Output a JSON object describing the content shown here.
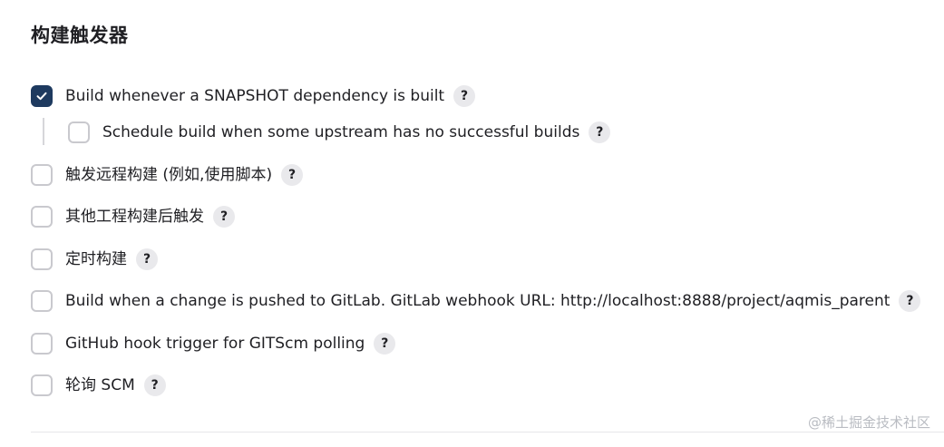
{
  "section": {
    "title": "构建触发器"
  },
  "options": [
    {
      "label": "Build whenever a SNAPSHOT dependency is built",
      "checked": true,
      "help": "?"
    },
    {
      "label": "Schedule build when some upstream has no successful builds",
      "checked": false,
      "help": "?"
    },
    {
      "label": "触发远程构建 (例如,使用脚本)",
      "checked": false,
      "help": "?"
    },
    {
      "label": "其他工程构建后触发",
      "checked": false,
      "help": "?"
    },
    {
      "label": "定时构建",
      "checked": false,
      "help": "?"
    },
    {
      "label": "Build when a change is pushed to GitLab. GitLab webhook URL: http://localhost:8888/project/aqmis_parent",
      "checked": false,
      "help": "?"
    },
    {
      "label": "GitHub hook trigger for GITScm polling",
      "checked": false,
      "help": "?"
    },
    {
      "label": "轮询 SCM",
      "checked": false,
      "help": "?"
    }
  ],
  "watermark": "@稀土掘金技术社区",
  "colors": {
    "checked_fill": "#1e3a5f",
    "checkbox_border": "#c9c9ce",
    "help_bg": "#e9e9ec"
  },
  "icons": {
    "checkmark": "check-icon",
    "help": "help-icon"
  }
}
